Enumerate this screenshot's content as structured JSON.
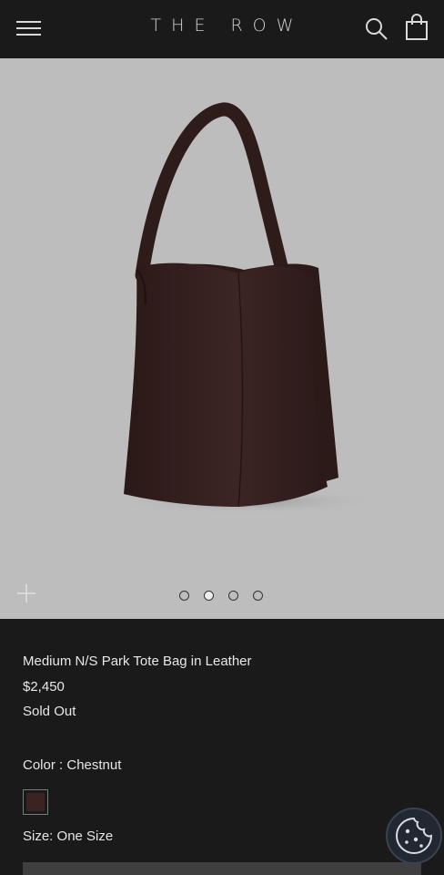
{
  "header": {
    "logo": "THE ROW",
    "menu_icon": "hamburger-menu-icon",
    "search_icon": "search-icon",
    "cart_icon": "shopping-bag-icon"
  },
  "gallery": {
    "zoom_icon": "plus-icon",
    "slides": 4,
    "active_slide": 2,
    "bag_color": "#3a2322"
  },
  "product": {
    "title": "Medium N/S Park Tote Bag in Leather",
    "price": "$2,450",
    "availability": "Sold Out",
    "color_label": "Color",
    "color_value": "Chestnut",
    "color_separator": " : ",
    "size_label": "Size:",
    "size_value": "One Size"
  },
  "cookie": {
    "icon": "cookie-icon"
  }
}
